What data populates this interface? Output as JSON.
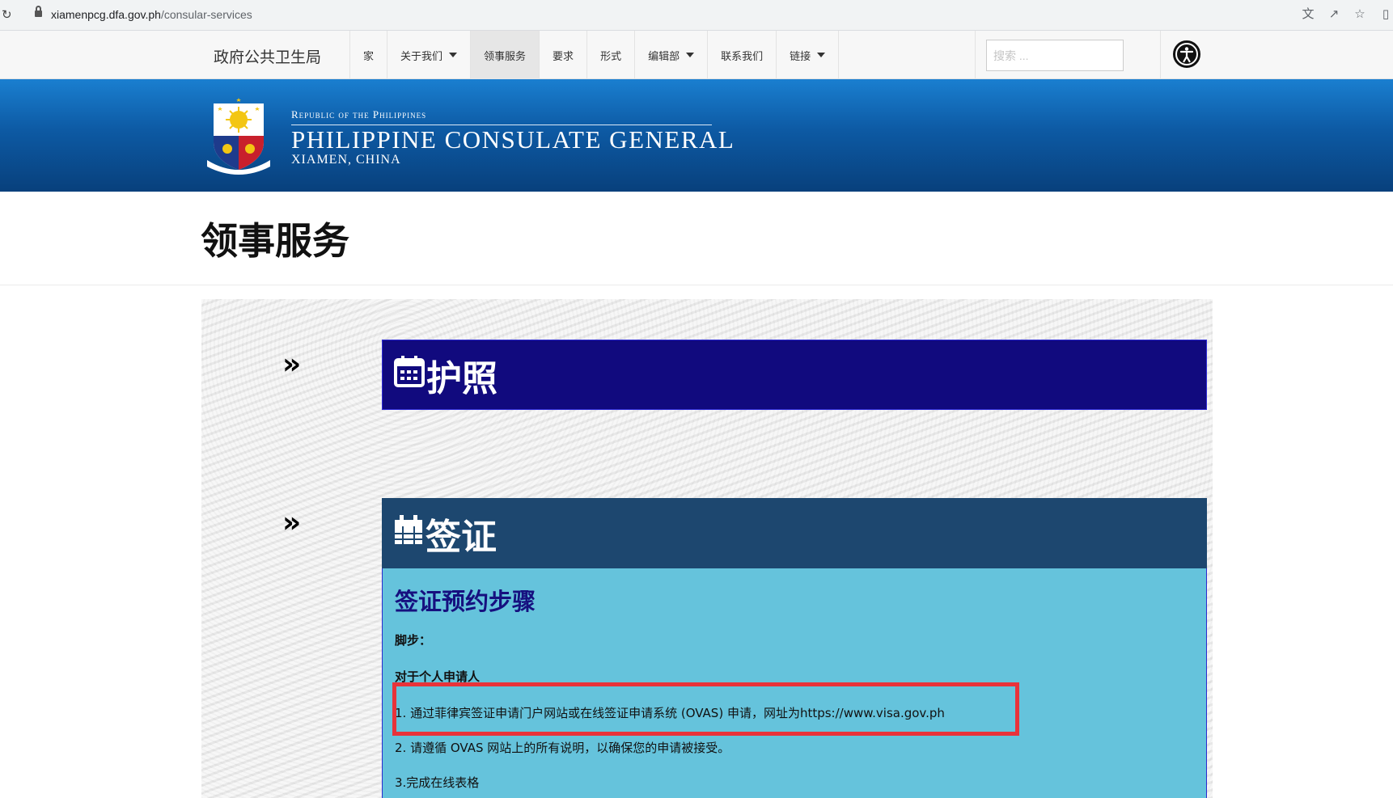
{
  "browser": {
    "url_domain": "xiamenpcg.dfa.gov.ph",
    "url_path": "/consular-services",
    "reload_icon": "reload-icon",
    "icons": [
      "translate-icon",
      "share-icon",
      "star-icon",
      "sidebar-icon"
    ]
  },
  "nav": {
    "brand": "政府公共卫生局",
    "items": [
      {
        "label": "家",
        "dropdown": false
      },
      {
        "label": "关于我们",
        "dropdown": true
      },
      {
        "label": "领事服务",
        "dropdown": false,
        "active": true
      },
      {
        "label": "要求",
        "dropdown": false
      },
      {
        "label": "形式",
        "dropdown": false
      },
      {
        "label": "编辑部",
        "dropdown": true
      },
      {
        "label": "联系我们",
        "dropdown": false
      },
      {
        "label": "链接",
        "dropdown": true
      }
    ],
    "search_placeholder": "搜索 ...",
    "accessibility_icon": "accessibility-icon"
  },
  "banner": {
    "small": "Republic of the Philippines",
    "big": "PHILIPPINE CONSULATE GENERAL",
    "location": "XIAMEN, CHINA",
    "seal_text": "REPUBLIC OF THE PHILIPPINES"
  },
  "page": {
    "title": "领事服务"
  },
  "sections": {
    "arrow": "»",
    "passport": {
      "title": "护照",
      "icon": "calendar-icon"
    },
    "visa": {
      "title": "签证",
      "icon": "calendar-grid-icon",
      "subtitle": "签证预约步骤",
      "label_steps": "脚步：",
      "label_individual": "对于个人申请人",
      "step1": "1. 通过菲律宾签证申请门户网站或在线签证申请系统 (OVAS) 申请，网址为https://www.visa.gov.ph",
      "step2": "2. 请遵循 OVAS 网站上的所有说明，以确保您的申请被接受。",
      "step3": "3.完成在线表格"
    }
  },
  "colors": {
    "banner_top": "#1a7fd0",
    "banner_bottom": "#08407c",
    "passport_header": "#110a7e",
    "visa_header": "#1d476f",
    "visa_body": "#65c3dc",
    "highlight": "#e8323a"
  }
}
